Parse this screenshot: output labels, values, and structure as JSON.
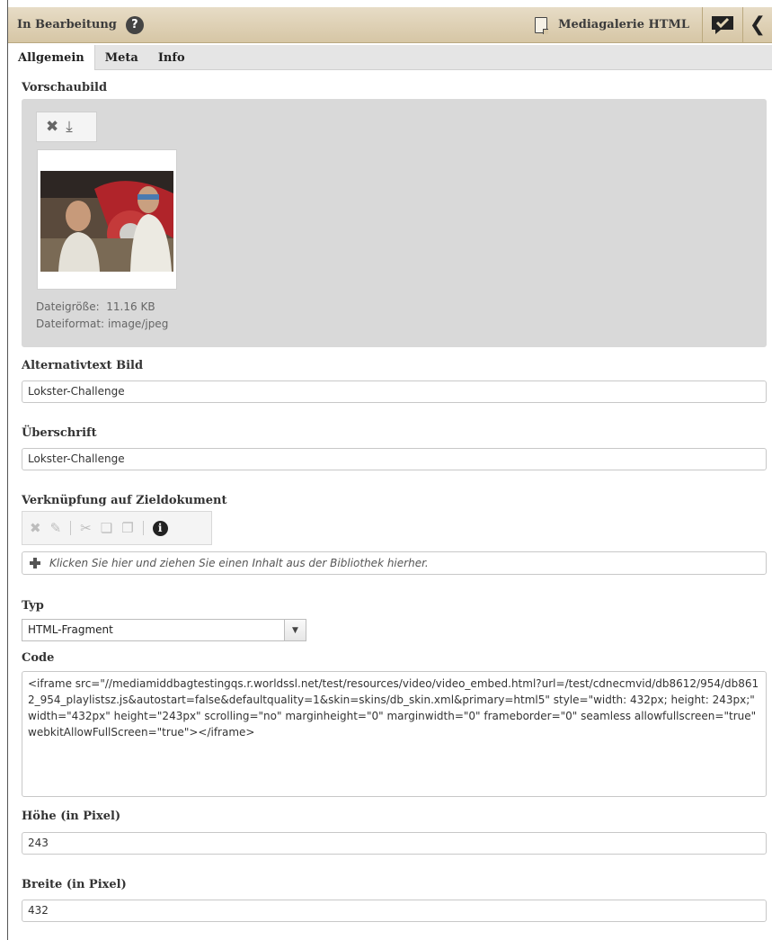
{
  "header": {
    "status": "In Bearbeitung",
    "help_icon_glyph": "?",
    "doctype": "Mediagalerie HTML"
  },
  "tabs": [
    {
      "label": "Allgemein",
      "active": true
    },
    {
      "label": "Meta",
      "active": false
    },
    {
      "label": "Info",
      "active": false
    }
  ],
  "preview": {
    "label": "Vorschaubild",
    "tools": [
      "remove-icon",
      "download-icon"
    ],
    "file_size_label": "Dateigröße:",
    "file_size": "11.16 KB",
    "file_format_label": "Dateiformat:",
    "file_format": "image/jpeg"
  },
  "alt_text": {
    "label": "Alternativtext Bild",
    "value": "Lokster-Challenge"
  },
  "heading": {
    "label": "Überschrift",
    "value": "Lokster-Challenge"
  },
  "link": {
    "label": "Verknüpfung auf Zieldokument",
    "tools": [
      "remove-icon",
      "edit-icon",
      "cut-icon",
      "copy-icon",
      "paste-icon",
      "info-icon"
    ],
    "placeholder": "Klicken Sie hier und ziehen Sie einen Inhalt aus der Bibliothek hierher."
  },
  "type": {
    "label": "Typ",
    "value": "HTML-Fragment"
  },
  "code": {
    "label": "Code",
    "value": "<iframe src=\"//mediamiddbagtestingqs.r.worldssl.net/test/resources/video/video_embed.html?url=/test/cdnecmvid/db8612/954/db8612_954_playlistsz.js&autostart=false&defaultquality=1&skin=skins/db_skin.xml&primary=html5\" style=\"width: 432px; height: 243px;\" width=\"432px\" height=\"243px\" scrolling=\"no\" marginheight=\"0\" marginwidth=\"0\" frameborder=\"0\" seamless allowfullscreen=\"true\" webkitAllowFullScreen=\"true\"></iframe>"
  },
  "height": {
    "label": "Höhe (in Pixel)",
    "value": "243"
  },
  "width": {
    "label": "Breite (in Pixel)",
    "value": "432"
  }
}
